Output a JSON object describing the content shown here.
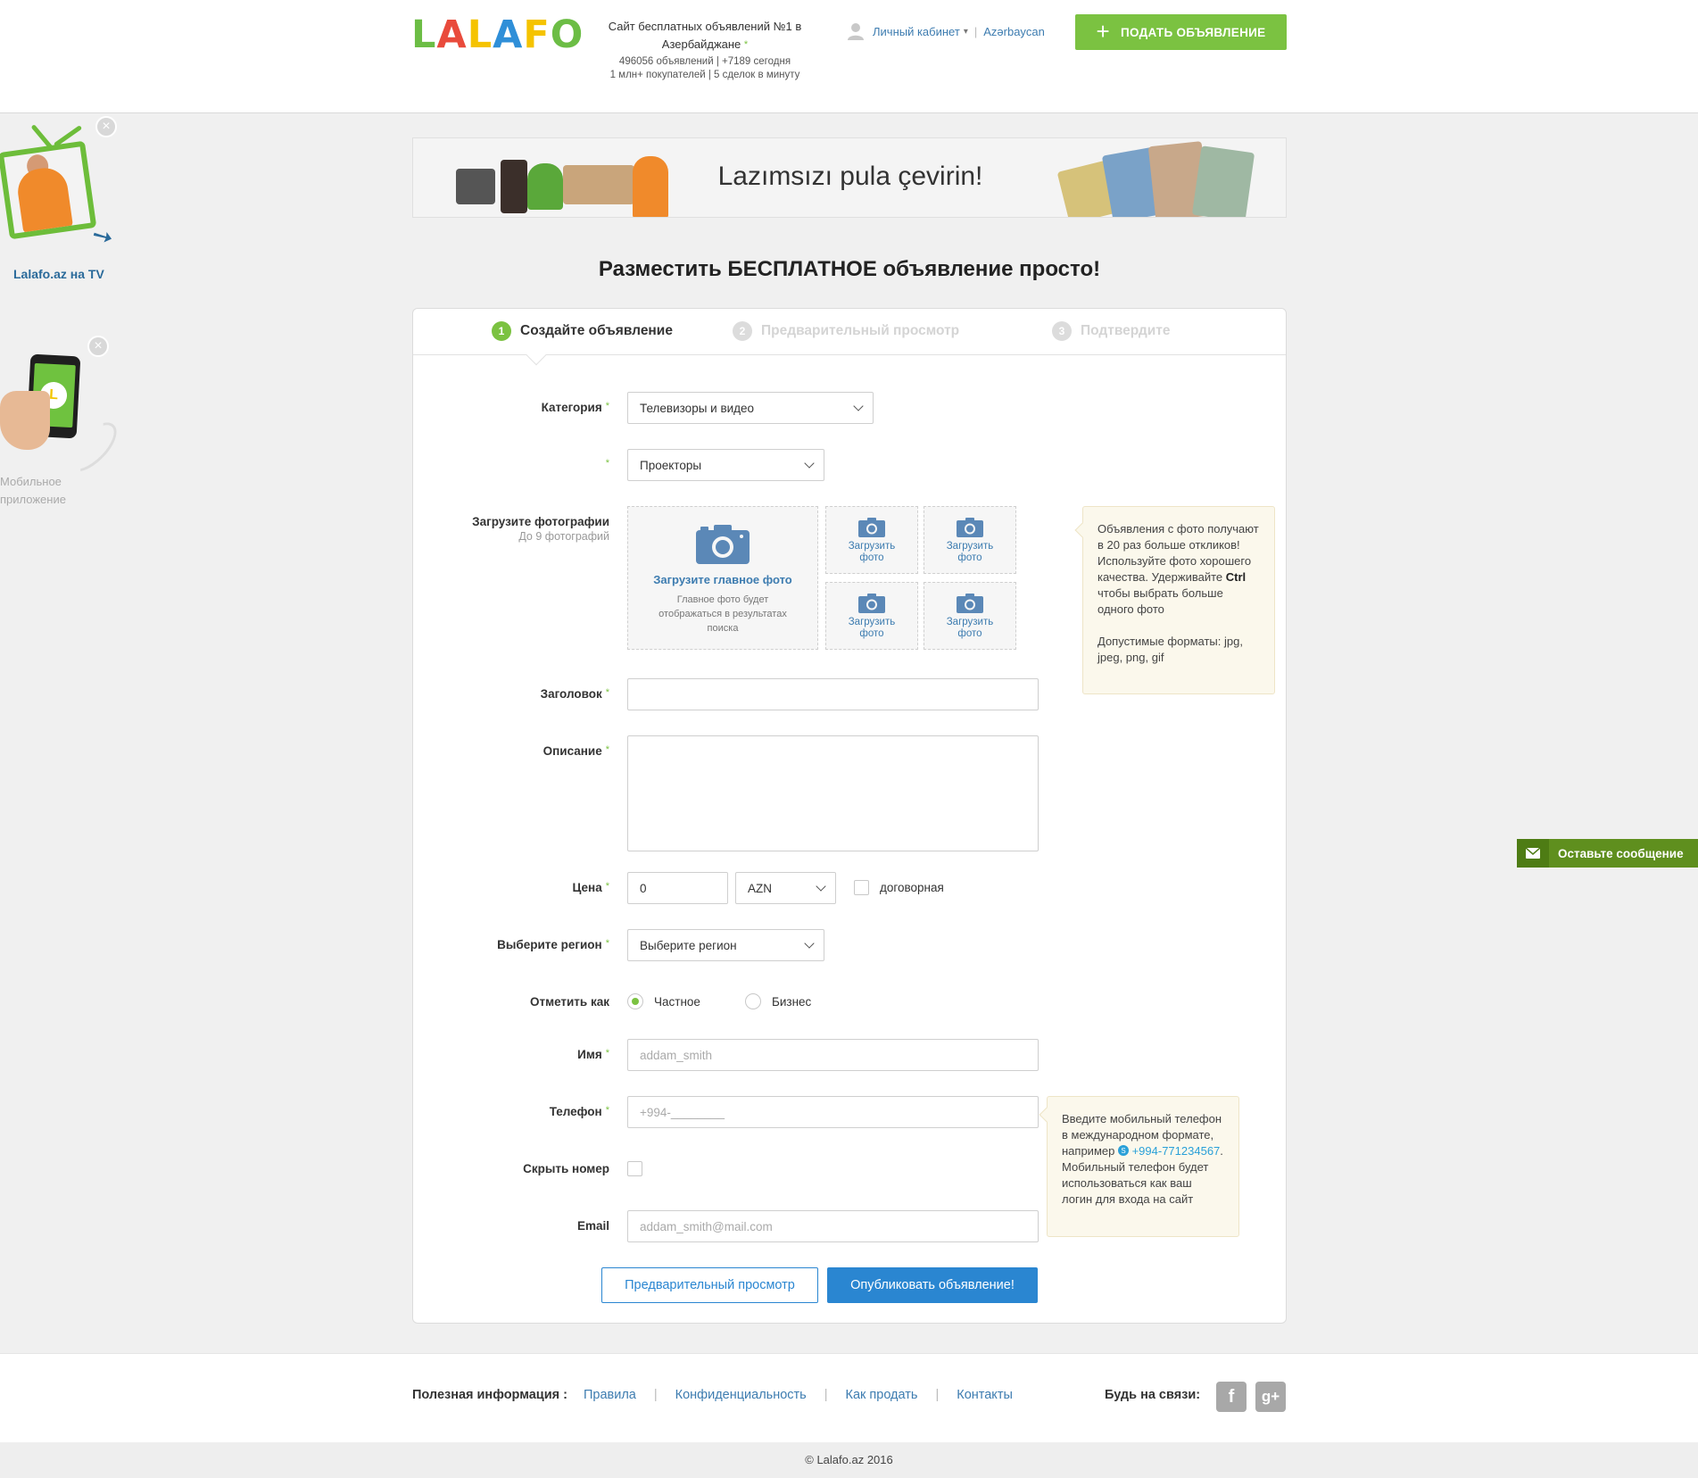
{
  "header": {
    "logo_letters": [
      "L",
      "A",
      "L",
      "A",
      "F",
      "O"
    ],
    "logo_colors": [
      "#6cbd45",
      "#e94b3c",
      "#f5c300",
      "#2f8fd8",
      "#f5c300",
      "#6cbd45"
    ],
    "tagline": "Сайт бесплатных объявлений №1 в Азербайджане",
    "tagline_star": "*",
    "stats_line1": "496056 объявлений  |  +7189 сегодня",
    "stats_line2": "1 млн+ покупателей  |  5 сделок в минуту",
    "account_label": "Личный кабинет",
    "language_label": "Azərbaycan",
    "post_button": "ПОДАТЬ ОБЪЯВЛЕНИЕ"
  },
  "promos": {
    "tv_label": "Lalafo.az на TV",
    "app_label_line1": "Мобильное",
    "app_label_line2": "приложение"
  },
  "banner": {
    "slogan": "Lazımsızı pula çevirin!"
  },
  "page_title": "Разместить БЕСПЛАТНОЕ объявление просто!",
  "steps": [
    {
      "num": "1",
      "label": "Создайте объявление",
      "active": true
    },
    {
      "num": "2",
      "label": "Предварительный просмотр",
      "active": false
    },
    {
      "num": "3",
      "label": "Подтвердите",
      "active": false
    }
  ],
  "form": {
    "category_label": "Категория",
    "category_value": "Телевизоры и видео",
    "subcategory_value": "Проекторы",
    "photos_label": "Загрузите фотографии",
    "photos_sublabel": "До 9 фотографий",
    "main_photo_title": "Загрузите главное фото",
    "main_photo_desc": "Главное фото будет отображаться в результатах поиска",
    "small_photo_label_1": "Загрузить",
    "small_photo_label_2": "фото",
    "photo_hint_p1_a": "Объявления с фото получают в 20 раз больше откликов! Используйте фото хорошего качества. Удерживайте ",
    "photo_hint_ctrl": "Ctrl",
    "photo_hint_p1_b": " чтобы выбрать больше одного фото",
    "photo_hint_p2": "Допустимые форматы: jpg, jpeg, png, gif",
    "title_label": "Заголовок",
    "title_value": "",
    "description_label": "Описание",
    "price_label": "Цена",
    "price_value": "0",
    "currency_value": "AZN",
    "negotiable_label": "договорная",
    "region_label": "Выберите регион",
    "region_value": "Выберите регион",
    "mark_as_label": "Отметить как",
    "private_label": "Частное",
    "business_label": "Бизнес",
    "name_label": "Имя",
    "name_placeholder": "addam_smith",
    "phone_label": "Телефон",
    "phone_placeholder": "+994-________",
    "phone_hint_a": "Введите мобильный телефон в международном формате, например",
    "phone_hint_example": "+994-771234567",
    "phone_hint_b": ". Мобильный телефон будет использоваться как ваш логин для входа на сайт",
    "hide_number_label": "Скрыть номер",
    "email_label": "Email",
    "email_placeholder": "addam_smith@mail.com",
    "required_mark": "*",
    "preview_button": "Предварительный просмотр",
    "publish_button": "Опубликовать объявление!"
  },
  "feedback_button": "Оставьте сообщение",
  "footer": {
    "info_label": "Полезная информация :",
    "links": [
      "Правила",
      "Конфиденциальность",
      "Как продать",
      "Контакты"
    ],
    "social_label": "Будь на связи:",
    "social_facebook": "f",
    "social_gplus": "g+",
    "copyright": "© Lalafo.az 2016"
  },
  "colors": {
    "brand_green": "#7bc241",
    "link_blue": "#3d7cb0",
    "button_blue": "#2a86d1",
    "hint_bg": "#fbf8ec"
  }
}
